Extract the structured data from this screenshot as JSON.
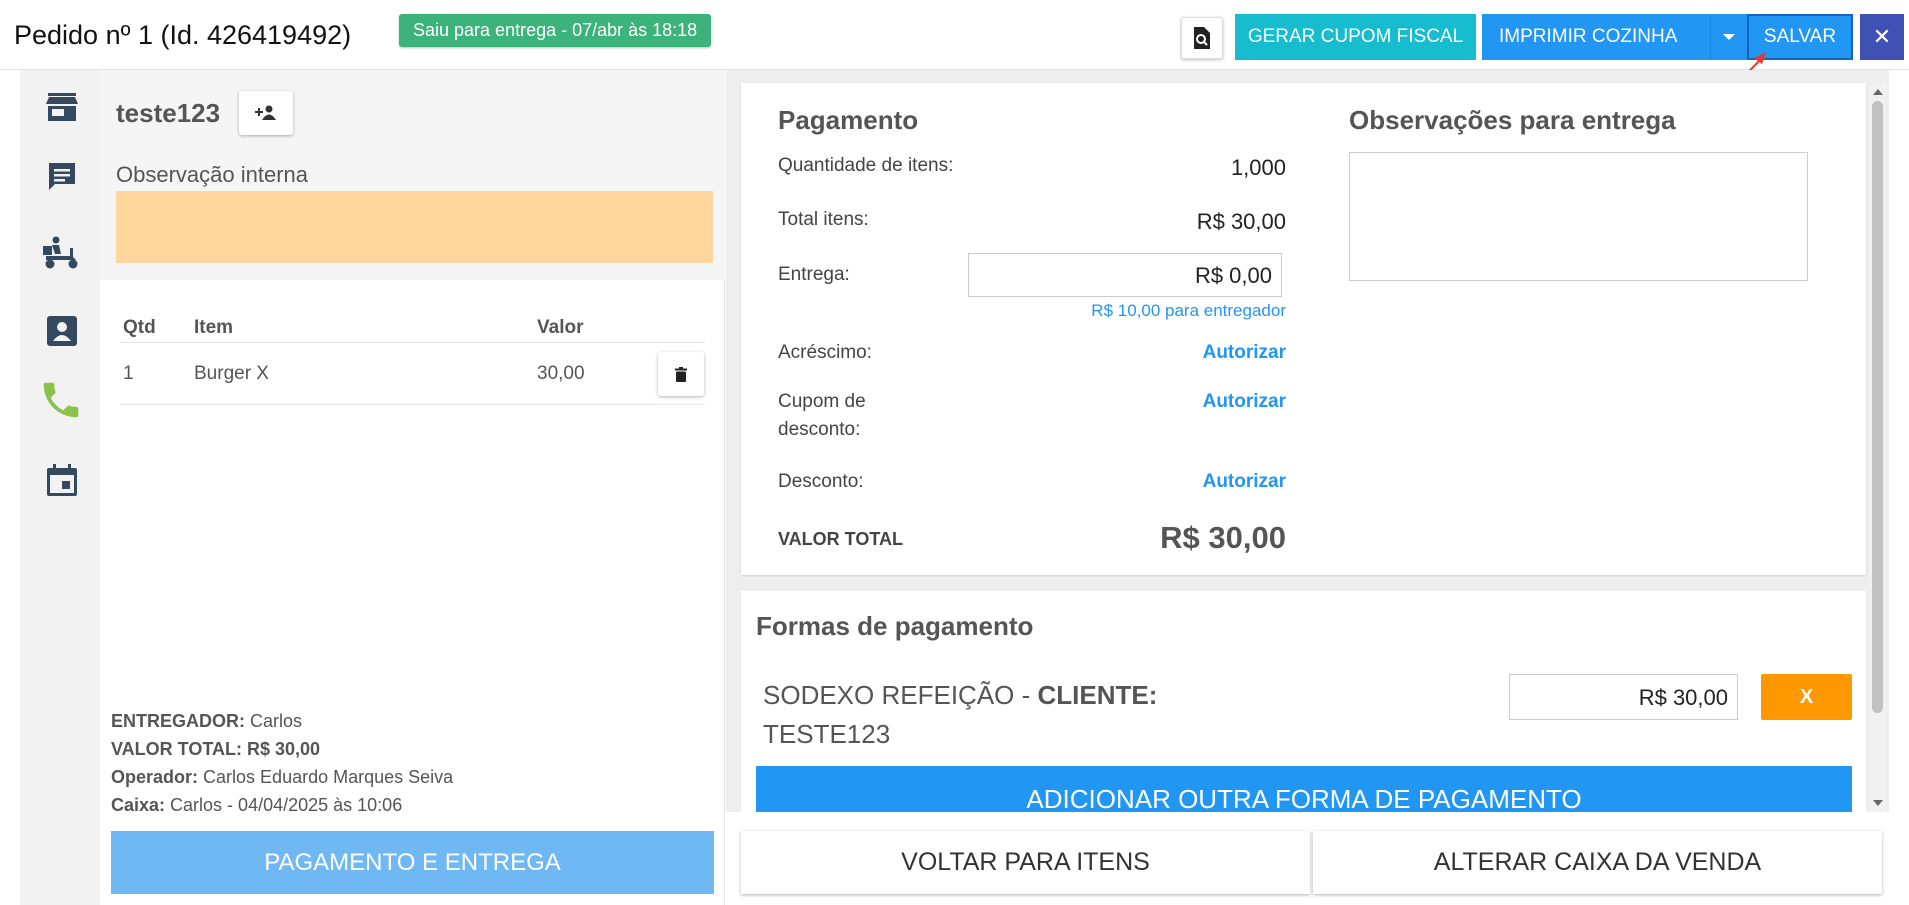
{
  "header": {
    "title": "Pedido nº 1 (Id. 426419492)",
    "status_badge": "Saiu para entrega - 07/abr às 18:18",
    "buttons": {
      "cupom": "GERAR CUPOM FISCAL",
      "cozinha": "IMPRIMIR COZINHA",
      "salvar": "SALVAR",
      "close": "✕"
    }
  },
  "sidebar": {
    "icons": [
      "store-icon",
      "chat-icon",
      "delivery-scooter-icon",
      "contact-card-icon",
      "phone-icon",
      "calendar-icon"
    ],
    "active_color": "#8bc34a",
    "icon_color": "#34495e"
  },
  "order": {
    "customer_name": "teste123",
    "internal_note_label": "Observação interna",
    "table_headers": {
      "qtd": "Qtd",
      "item": "Item",
      "valor": "Valor"
    },
    "items": [
      {
        "qtd": "1",
        "item": "Burger X",
        "valor": "30,00"
      }
    ],
    "summary": {
      "entregador_label": "ENTREGADOR:",
      "entregador_value": "Carlos",
      "total_label": "VALOR TOTAL:",
      "total_value": "R$ 30,00",
      "operador_label": "Operador:",
      "operador_value": "Carlos Eduardo Marques Seiva",
      "caixa_label": "Caixa:",
      "caixa_value": "Carlos - 04/04/2025 às 10:06"
    },
    "pay_button": "PAGAMENTO E ENTREGA"
  },
  "payment": {
    "title": "Pagamento",
    "qty_label": "Quantidade de itens:",
    "qty_value": "1,000",
    "total_items_label": "Total itens:",
    "total_items_value": "R$ 30,00",
    "delivery_label": "Entrega:",
    "delivery_value": "R$ 0,00",
    "delivery_note": "R$ 10,00 para entregador",
    "surcharge_label": "Acréscimo:",
    "coupon_label_1": "Cupom de",
    "coupon_label_2": "desconto:",
    "discount_label": "Desconto:",
    "authorize": "Autorizar",
    "total_label": "VALOR TOTAL",
    "total_value": "R$ 30,00",
    "obs_title": "Observações para entrega"
  },
  "payment_methods": {
    "title": "Formas de pagamento",
    "method_prefix": "SODEXO REFEIÇÃO - ",
    "method_client_label": "CLIENTE:",
    "method_client": "TESTE123",
    "method_value": "R$ 30,00",
    "remove": "X",
    "add_button": "ADICIONAR OUTRA FORMA DE PAGAMENTO"
  },
  "footer": {
    "back": "VOLTAR PARA ITENS",
    "change_register": "ALTERAR CAIXA DA VENDA"
  }
}
